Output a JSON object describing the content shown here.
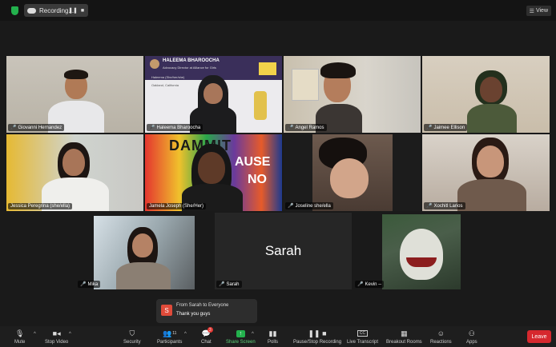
{
  "topbar": {
    "recording_label": "Recording...",
    "pause_glyph": "❚❚",
    "stop_glyph": "■",
    "view_label": "View",
    "view_icon": "grid-icon"
  },
  "participants": [
    {
      "name": "Giovanni Hernandez",
      "muted": true
    },
    {
      "name": "Haleema Bharoocha",
      "muted": true
    },
    {
      "name": "Angel Ramos",
      "muted": true
    },
    {
      "name": "Jaimee Ellison",
      "muted": true
    },
    {
      "name": "Jessica Peregrina (she/ella)",
      "muted": false,
      "active_speaker": true
    },
    {
      "name": "Jamela Joseph (She/Her)",
      "muted": true
    },
    {
      "name": "Joseline she/ella",
      "muted": true
    },
    {
      "name": "Xochitl Larios",
      "muted": true
    },
    {
      "name": "Mika",
      "muted": true
    },
    {
      "name": "Sarah",
      "muted": true,
      "video_off": true
    },
    {
      "name": "Kevin --",
      "muted": true
    }
  ],
  "haleema_card": {
    "name": "HALEEMA BHAROOCHA",
    "title": "Advocacy Director at Alliance for Girls",
    "pronouns": "Haleema (She/her/she)",
    "location": "Oakland, California"
  },
  "jamela_mural": {
    "line1": "DAMMIT",
    "line2": "AUSE",
    "line3": "NO"
  },
  "chat": {
    "avatar_letter": "S",
    "from": "From Sarah to Everyone",
    "message": "Thank you guys"
  },
  "toolbar": {
    "mute": "Mute",
    "stop_video": "Stop Video",
    "security": "Security",
    "participants": "Participants",
    "participants_count": "11",
    "chat": "Chat",
    "chat_badge": "3",
    "share_screen": "Share Screen",
    "polls": "Polls",
    "recording": "Pause/Stop Recording",
    "live_transcript": "Live Transcript",
    "cc_label": "CC",
    "breakout_rooms": "Breakout Rooms",
    "reactions": "Reactions",
    "apps": "Apps",
    "leave": "Leave"
  },
  "colors": {
    "active_speaker_border": "#d9e26a",
    "share_green": "#23b14d",
    "leave_red": "#d6282e",
    "muted_red": "#e53935"
  }
}
